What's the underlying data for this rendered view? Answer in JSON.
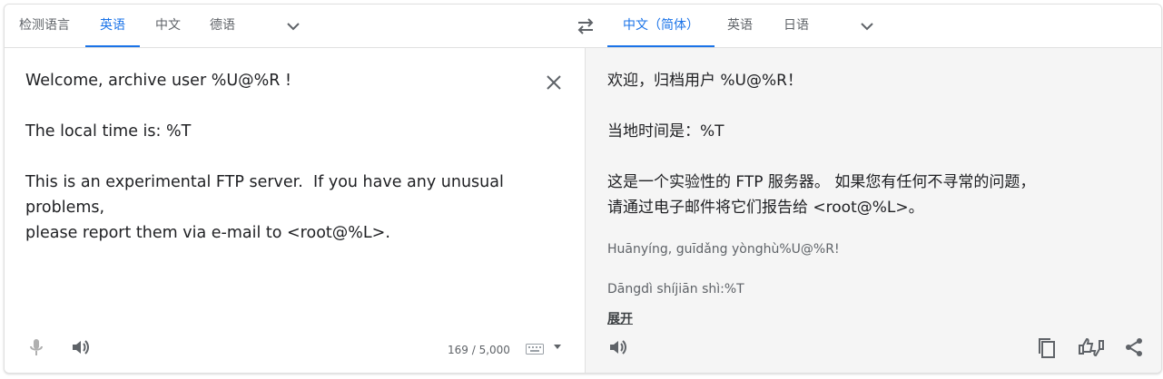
{
  "source_langs": {
    "tabs": [
      "检测语言",
      "英语",
      "中文",
      "德语"
    ],
    "active_index": 1
  },
  "target_langs": {
    "tabs": [
      "中文（简体）",
      "英语",
      "日语"
    ],
    "active_index": 0
  },
  "source": {
    "text": "Welcome, archive user %U@%R !\n\nThe local time is: %T\n\nThis is an experimental FTP server.  If you have any unusual\nproblems,\nplease report them via e-mail to <root@%L>.",
    "char_count": "169 / 5,000"
  },
  "target": {
    "text": "欢迎，归档用户 %U@%R！\n\n当地时间是：%T\n\n这是一个实验性的 FTP 服务器。 如果您有任何不寻常的问题，\n请通过电子邮件将它们报告给 <root@%L>。",
    "pinyin_line1": "Huānyíng, guīdǎng yònghù%U@%R!",
    "pinyin_line2": "Dāngdì shíjiān shì:%T",
    "expand_label": "展开"
  },
  "icons": {
    "swap": "swap-languages-icon",
    "clear": "close-icon",
    "mic": "microphone-icon",
    "speaker": "speaker-icon",
    "keyboard": "keyboard-icon",
    "copy": "copy-icon",
    "rate": "rate-translation-icon",
    "share": "share-icon"
  },
  "colors": {
    "accent": "#1a73e8",
    "text": "#202124",
    "muted": "#5f6368",
    "target_bg": "#f5f5f5"
  }
}
